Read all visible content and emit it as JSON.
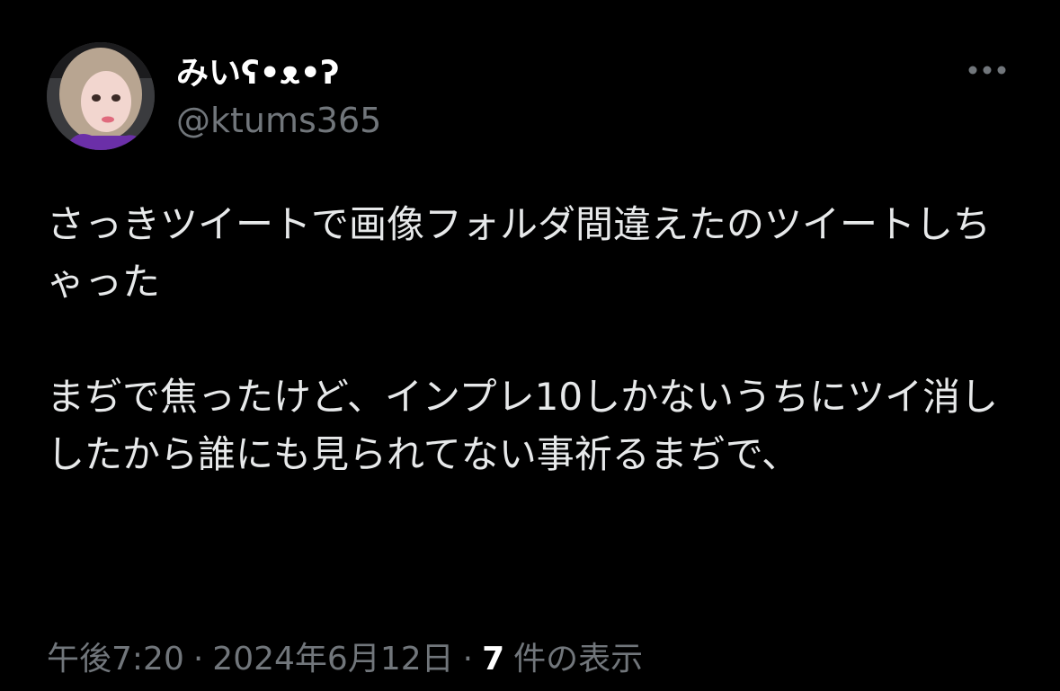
{
  "user": {
    "display_name": "みいʕ•ᴥ•ʔ",
    "handle": "@ktums365",
    "avatar_icon": "profile-photo-icon"
  },
  "tweet": {
    "paragraph1": "さっきツイートで画像フォルダ間違えたのツイートしちゃった",
    "paragraph2": "まぢで焦ったけど、インプレ10しかないうちにツイ消ししたから誰にも見られてない事祈るまぢで、"
  },
  "meta": {
    "time": "午後7:20",
    "separator1": "·",
    "date": "2024年6月12日",
    "separator2": "·",
    "views_count": "7",
    "views_label": "件の表示"
  },
  "actions": {
    "more_icon": "more-horizontal-icon"
  },
  "colors": {
    "background": "#000000",
    "primary_text": "#e7e9ea",
    "secondary_text": "#71767b"
  }
}
